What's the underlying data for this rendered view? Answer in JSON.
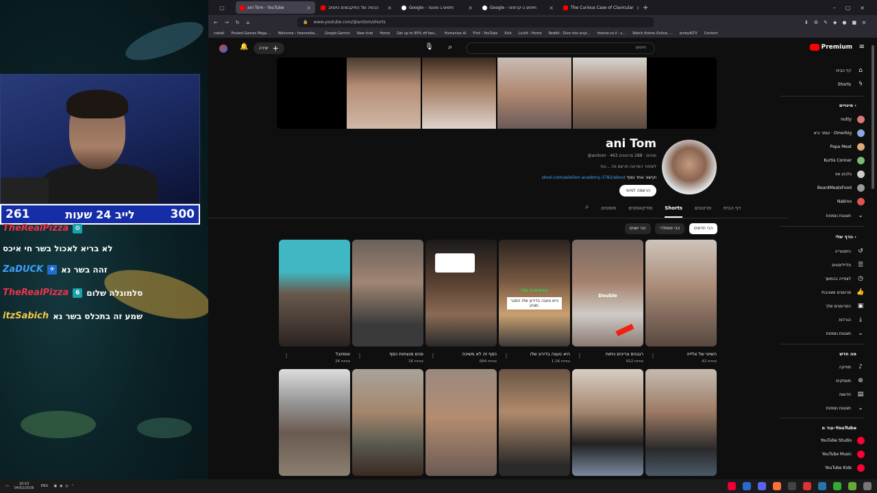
{
  "overlay": {
    "timer_left": "261",
    "timer_label": "לייב 24 שעות",
    "timer_right": "300",
    "chat": [
      {
        "user": "TheRealPizza",
        "msg": "",
        "color": "#e8344e"
      },
      {
        "user": "",
        "msg": "לא בריא לאכול בשר חי איכס",
        "color": "#ffffff"
      },
      {
        "user": "ZaDUCK",
        "msg": "זהה בשר נא",
        "color": "#3aa0ff"
      },
      {
        "user": "TheRealPizza",
        "msg": "סלמונלה שלום",
        "color": "#e8344e"
      },
      {
        "user": "itzSabich",
        "msg": "שמע זה בתכלס בשר נא",
        "color": "#f2c94c"
      }
    ]
  },
  "browser": {
    "tabs": [
      {
        "title": "ani Tom - YouTube",
        "fav": "#ff0000",
        "active": true
      },
      {
        "title": "הבעיה של התיקבוצים כיוטיוב",
        "fav": "#ff0000",
        "active": false
      },
      {
        "title": "Google - חיפוש ב-מונטר",
        "fav": "#ffffff",
        "active": false
      },
      {
        "title": "Google - חיפוש ב-קרופוני",
        "fav": "#ffffff",
        "active": false
      },
      {
        "title": "The Curious Case of Clavicular",
        "fav": "#ff0000",
        "active": false
      }
    ],
    "url": "www.youtube.com/@anitom/shorts",
    "bookmarks": [
      "cobalt",
      "Pirated Games Mega ...",
      "Welcome › freemedia...",
      "Google Gemini",
      "New chat",
      "Home",
      "Get up to 90% off bes...",
      "Humanize AI",
      "Flint - YouTube",
      "Kick",
      "Lurkit - Home",
      "Reddit - Dive into anyt...",
      "htzone.co.il - פ...",
      "Watch Anime Online, ...",
      "emby4LTV",
      "Content"
    ]
  },
  "yt": {
    "search_placeholder": "חיפוש",
    "create_label": "יצירה",
    "premium": "Premium",
    "channel": {
      "name": "ani Tom",
      "stats": "@anitom · 463 מנויים · 288 סרטונים",
      "desc": "לשיפור המראה תרשם פה ...עוד",
      "link": "skool.com/astelion-academy-3782/about",
      "link_suffix": "וקישור אחד נוסף",
      "subscribe": "הרשמה למינוי"
    },
    "tabs": [
      "דף הבית",
      "סרטונים",
      "Shorts",
      "פודקאסטים",
      "פוסטים"
    ],
    "chips": [
      "הכי חדשים",
      "הכי פופולרי",
      "הכי ישנים"
    ],
    "shorts_row1": [
      {
        "title": "השינוי של אלייה",
        "views": "42 צפיות"
      },
      {
        "title": "רגבנים צריכים ניתוח",
        "views": "912 צפיות"
      },
      {
        "title": "היא טענה בדירוג שלו",
        "views": "1.1K צפיות"
      },
      {
        "title": "כסף זה לא משיכה",
        "views": "684 צפיות"
      },
      {
        "title": "פנים מנצחות כסף",
        "views": "1K צפיות"
      },
      {
        "title": "אומינגל",
        "views": "2K צפיות"
      }
    ],
    "overlay_texts": [
      "האמיתית שלו",
      "Double",
      "היא טענה בדירוג שלו הסבר מגיע:"
    ],
    "sidebar": {
      "main": [
        "דף הבית",
        "Shorts"
      ],
      "subs_header": "מינויים",
      "subs": [
        {
          "name": "nutty",
          "color": "#d77"
        },
        {
          "name": "עומר ביא · Omerbig",
          "color": "#8ad"
        },
        {
          "name": "Papa Meat",
          "color": "#da7"
        },
        {
          "name": "Kurtis Conner",
          "color": "#7b7"
        },
        {
          "name": "גלבוע אוו",
          "color": "#ccc"
        },
        {
          "name": "BeardMeatsFood",
          "color": "#999"
        },
        {
          "name": "Nabino",
          "color": "#d55"
        }
      ],
      "show_more": "תצוגות נוספות",
      "you_header": "הדף שלי",
      "you": [
        "היסטוריה",
        "פלייליסטים",
        "לצפייה בהמשך",
        "סרטונים שאהבתי",
        "הסרטונים שלך",
        "הורדות"
      ],
      "explore_header": "מה חדש",
      "explore": [
        "מוזיקה",
        "משחקים",
        "חדשות"
      ],
      "more_header": "עוד מ-YouTube",
      "more": [
        "YouTube Studio",
        "YouTube Music",
        "YouTube Kids"
      ]
    }
  },
  "taskbar": {
    "lang": "ENG",
    "time": "20:53",
    "date": "04/02/2026"
  }
}
